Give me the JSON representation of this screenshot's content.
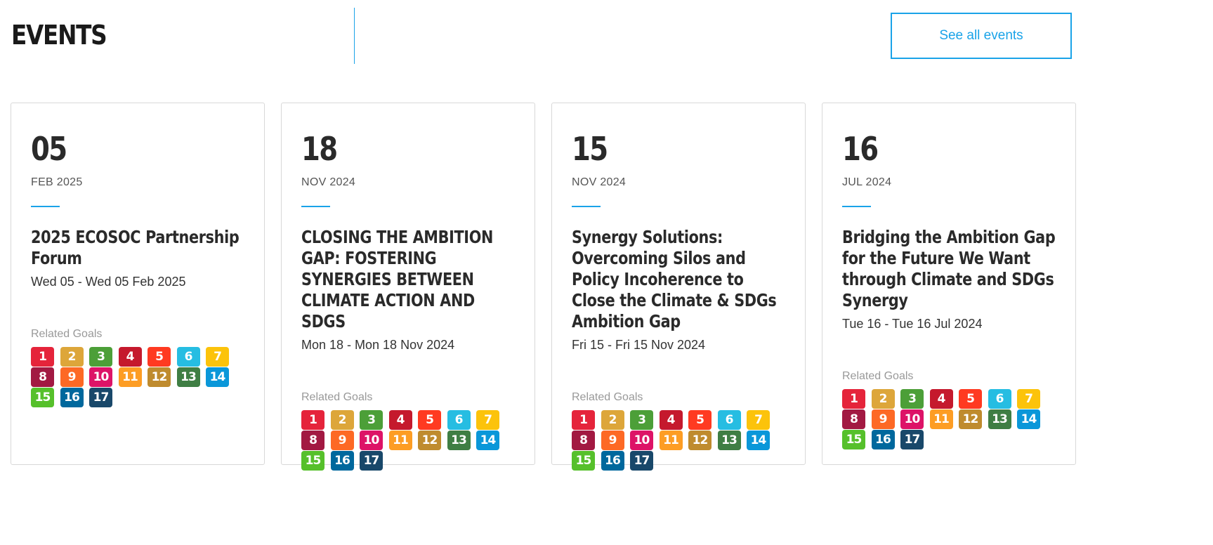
{
  "header": {
    "title": "EVENTS",
    "see_all_label": "See all events"
  },
  "related_label": "Related Goals",
  "goal_colors": [
    "#e5243b",
    "#dda63a",
    "#4c9f38",
    "#c5192d",
    "#ff3a21",
    "#26bde2",
    "#fcc30b",
    "#a21942",
    "#fd6925",
    "#dd1367",
    "#fd9d24",
    "#bf8b2e",
    "#3f7e44",
    "#0a97d9",
    "#56c02b",
    "#00689d",
    "#19486a"
  ],
  "events": [
    {
      "day": "05",
      "month": "FEB 2025",
      "title": "2025 ECOSOC Partnership Forum",
      "dates": "Wed 05 - Wed 05 Feb 2025",
      "goals": [
        "1",
        "2",
        "3",
        "4",
        "5",
        "6",
        "7",
        "8",
        "9",
        "10",
        "11",
        "12",
        "13",
        "14",
        "15",
        "16",
        "17"
      ]
    },
    {
      "day": "18",
      "month": "NOV 2024",
      "title": "CLOSING THE AMBITION GAP: FOSTERING SYNERGIES BETWEEN CLIMATE ACTION AND SDGS",
      "dates": "Mon 18 - Mon 18 Nov 2024",
      "goals": [
        "1",
        "2",
        "3",
        "4",
        "5",
        "6",
        "7",
        "8",
        "9",
        "10",
        "11",
        "12",
        "13",
        "14",
        "15",
        "16",
        "17"
      ]
    },
    {
      "day": "15",
      "month": "NOV 2024",
      "title": "Synergy Solutions: Overcoming Silos and Policy Incoherence to Close the Climate & SDGs Ambition Gap",
      "dates": "Fri 15 - Fri 15 Nov 2024",
      "goals": [
        "1",
        "2",
        "3",
        "4",
        "5",
        "6",
        "7",
        "8",
        "9",
        "10",
        "11",
        "12",
        "13",
        "14",
        "15",
        "16",
        "17"
      ]
    },
    {
      "day": "16",
      "month": "JUL 2024",
      "title": "Bridging the Ambition Gap for the Future We Want through Climate and SDGs Synergy",
      "dates": "Tue 16 - Tue 16 Jul 2024",
      "goals": [
        "1",
        "2",
        "3",
        "4",
        "5",
        "6",
        "7",
        "8",
        "9",
        "10",
        "11",
        "12",
        "13",
        "14",
        "15",
        "16",
        "17"
      ]
    }
  ]
}
